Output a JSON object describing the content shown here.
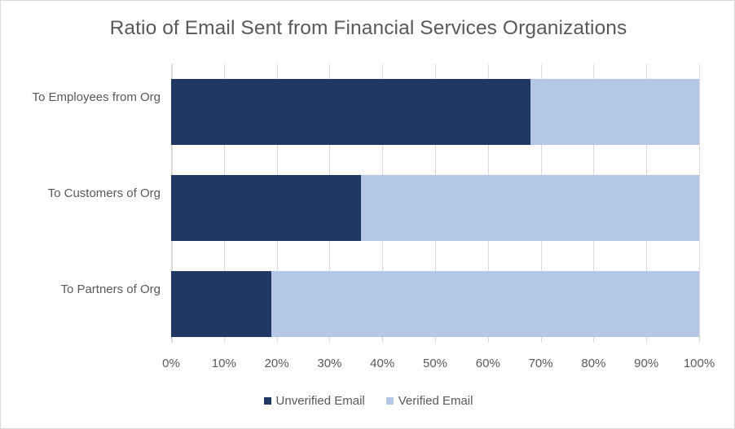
{
  "chart_data": {
    "type": "bar",
    "orientation": "horizontal",
    "stacked": true,
    "normalized": true,
    "title": "Ratio of Email Sent from Financial Services Organizations",
    "xlabel": "",
    "ylabel": "",
    "xlim": [
      0,
      100
    ],
    "xticks": [
      "0%",
      "10%",
      "20%",
      "30%",
      "40%",
      "50%",
      "60%",
      "70%",
      "80%",
      "90%",
      "100%"
    ],
    "xtick_values": [
      0,
      10,
      20,
      30,
      40,
      50,
      60,
      70,
      80,
      90,
      100
    ],
    "grid": "vertical",
    "legend_position": "bottom",
    "categories": [
      "To Employees from Org",
      "To Customers of Org",
      "To Partners of Org"
    ],
    "series": [
      {
        "name": "Unverified Email",
        "color": "#1F3864",
        "values": [
          68,
          36,
          19
        ]
      },
      {
        "name": "Verified Email",
        "color": "#B4C7E7",
        "values": [
          32,
          64,
          81
        ]
      }
    ],
    "colors": {
      "unverified": "#1F3864",
      "verified": "#B4C7E7",
      "text": "#595959",
      "gridline": "#D9D9D9",
      "border": "#D9D9D9",
      "background": "#FFFFFF"
    }
  }
}
